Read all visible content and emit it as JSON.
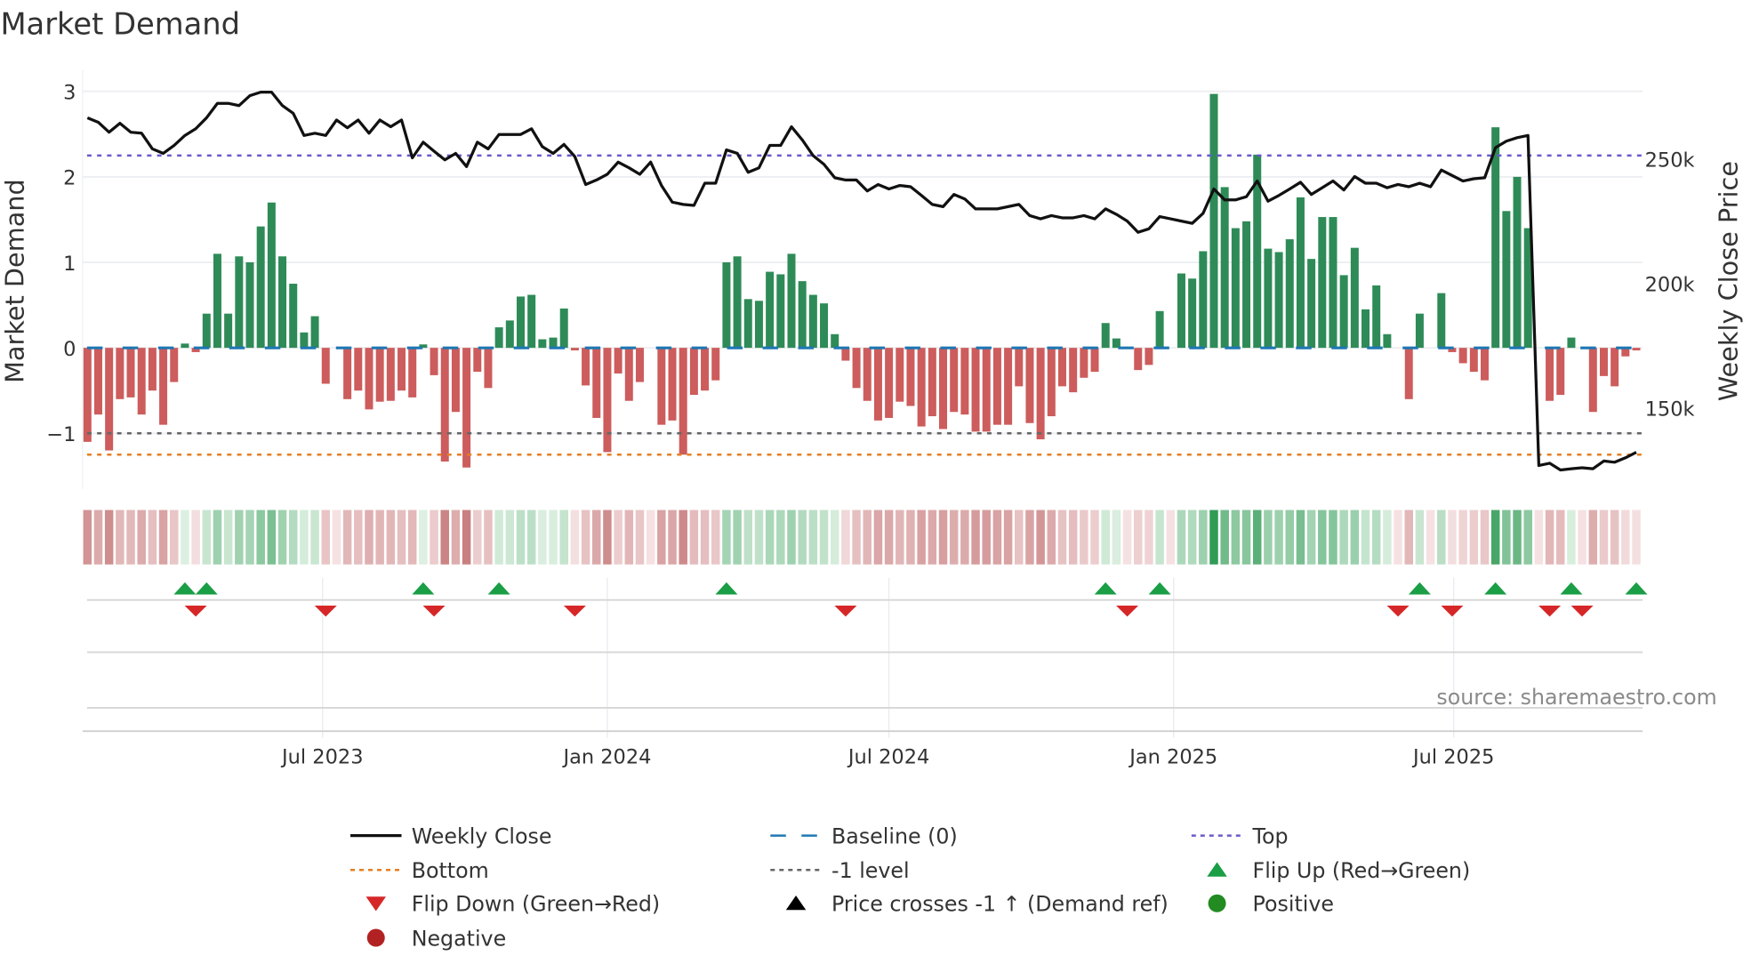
{
  "chart_data": {
    "type": "bar",
    "title": "Market Demand",
    "ylabel": "Market Demand",
    "y2label": "Weekly Close Price",
    "ylim": [
      -1.65,
      3.25
    ],
    "y2lim": [
      117400,
      285700
    ],
    "grid": true,
    "legend_placement": "bottom",
    "start_week": "2023-01-30",
    "frequency": "weekly",
    "yticks": [
      {
        "v": 3,
        "label": "3"
      },
      {
        "v": 2,
        "label": "2"
      },
      {
        "v": 1,
        "label": "1"
      },
      {
        "v": 0,
        "label": "0"
      },
      {
        "v": -1,
        "label": "−1"
      }
    ],
    "y2ticks": [
      {
        "v": 250000,
        "label": "250k"
      },
      {
        "v": 200000,
        "label": "200k"
      },
      {
        "v": 150000,
        "label": "150k"
      }
    ],
    "xticks": [
      {
        "date": "2023-07-01",
        "label": "Jul 2023"
      },
      {
        "date": "2024-01-01",
        "label": "Jan 2024"
      },
      {
        "date": "2024-07-01",
        "label": "Jul 2024"
      },
      {
        "date": "2025-01-01",
        "label": "Jan 2025"
      },
      {
        "date": "2025-07-01",
        "label": "Jul 2025"
      }
    ],
    "levels": {
      "top": 2.25,
      "bottom": -1.25,
      "minus_one": -1,
      "baseline": 0
    },
    "demand": [
      -1.1,
      -0.78,
      -1.2,
      -0.6,
      -0.58,
      -0.78,
      -0.5,
      -0.9,
      -0.4,
      0.05,
      -0.05,
      0.4,
      1.1,
      0.4,
      1.07,
      1.0,
      1.42,
      1.7,
      1.07,
      0.75,
      0.18,
      0.37,
      -0.42,
      0,
      -0.6,
      -0.5,
      -0.72,
      -0.63,
      -0.62,
      -0.5,
      -0.58,
      0.04,
      -0.32,
      -1.33,
      -0.75,
      -1.4,
      -0.28,
      -0.47,
      0.24,
      0.32,
      0.6,
      0.62,
      0.1,
      0.12,
      0.46,
      -0.03,
      -0.44,
      -0.82,
      -1.22,
      -0.3,
      -0.62,
      -0.4,
      0,
      -0.9,
      -0.85,
      -1.25,
      -0.55,
      -0.5,
      -0.38,
      1.0,
      1.07,
      0.57,
      0.55,
      0.89,
      0.86,
      1.1,
      0.78,
      0.62,
      0.52,
      0.16,
      -0.15,
      -0.47,
      -0.62,
      -0.85,
      -0.82,
      -0.63,
      -0.68,
      -0.92,
      -0.8,
      -0.95,
      -0.75,
      -0.78,
      -0.98,
      -0.98,
      -0.9,
      -0.9,
      -0.45,
      -0.88,
      -1.07,
      -0.8,
      -0.45,
      -0.52,
      -0.35,
      -0.28,
      0.29,
      0.11,
      0,
      -0.26,
      -0.2,
      0.43,
      0,
      0.87,
      0.81,
      1.13,
      2.97,
      1.88,
      1.4,
      1.48,
      2.26,
      1.16,
      1.12,
      1.27,
      1.76,
      1.04,
      1.53,
      1.53,
      0.85,
      1.17,
      0.45,
      0.73,
      0.16,
      0,
      -0.6,
      0.4,
      0,
      0.64,
      -0.05,
      -0.18,
      -0.28,
      -0.38,
      2.58,
      1.6,
      2.0,
      1.4,
      0,
      -0.62,
      -0.55,
      0.12,
      0,
      -0.75,
      -0.33,
      -0.45,
      -0.1,
      -0.03
    ],
    "weekly_close": [
      266500,
      264700,
      260700,
      264300,
      260700,
      260300,
      254000,
      252200,
      255400,
      259400,
      262100,
      266500,
      272300,
      272300,
      271400,
      275400,
      276800,
      276800,
      271400,
      268300,
      259400,
      260300,
      259400,
      265600,
      262500,
      265600,
      260300,
      265600,
      262900,
      265600,
      250400,
      256700,
      253100,
      249600,
      252200,
      246900,
      256700,
      254000,
      259800,
      259800,
      259800,
      262100,
      254900,
      252200,
      255800,
      250900,
      239700,
      241500,
      243800,
      248700,
      246400,
      243800,
      248700,
      239300,
      232600,
      231700,
      231300,
      240200,
      240200,
      253600,
      252200,
      244600,
      246400,
      255400,
      255400,
      262900,
      257600,
      251300,
      247800,
      242400,
      241500,
      241500,
      237100,
      239700,
      237900,
      239300,
      238800,
      235300,
      231700,
      230800,
      235700,
      233900,
      229900,
      229900,
      229900,
      230800,
      231700,
      227200,
      225900,
      227200,
      226300,
      226300,
      227200,
      225900,
      229900,
      227700,
      225000,
      220500,
      221900,
      226800,
      225900,
      225000,
      224100,
      228100,
      237900,
      233500,
      233500,
      234800,
      241100,
      233000,
      235300,
      237900,
      240600,
      235700,
      238400,
      241100,
      237500,
      242900,
      240200,
      240200,
      238400,
      239700,
      238800,
      240200,
      238800,
      245500,
      243300,
      241100,
      242000,
      242400,
      254500,
      257100,
      258500,
      259400,
      126800,
      127700,
      125000,
      125500,
      125900,
      125500,
      128600,
      128100,
      129900,
      132100
    ],
    "flip_up_weeks": [
      9,
      11,
      31,
      38,
      59,
      94,
      99,
      123,
      130,
      137,
      143
    ],
    "flip_down_weeks": [
      10,
      22,
      32,
      45,
      70,
      96,
      121,
      126,
      135,
      138
    ],
    "colors": {
      "positive": "#2e8b57",
      "negative": "#cd5c5c",
      "price": "#111111",
      "baseline": "#1f77b4",
      "top": "#6a5acd",
      "bottom": "#e67e22",
      "minus_one": "#666666",
      "flip_up": "#1a9e46",
      "flip_down": "#d62728",
      "heat_pos_light": "#dff1e3",
      "heat_pos_dark": "#2f9a55",
      "heat_neg_light": "#f5e1e2",
      "heat_neg_dark": "#c97f80"
    },
    "legend": [
      "Weekly Close",
      "Baseline (0)",
      "Top",
      "Bottom",
      "-1 level",
      "Flip Up (Red→Green)",
      "Flip Down (Green→Red)",
      "Price crosses -1 ↑ (Demand ref)",
      "Positive",
      "Negative"
    ],
    "source": "source: sharemaestro.com"
  }
}
